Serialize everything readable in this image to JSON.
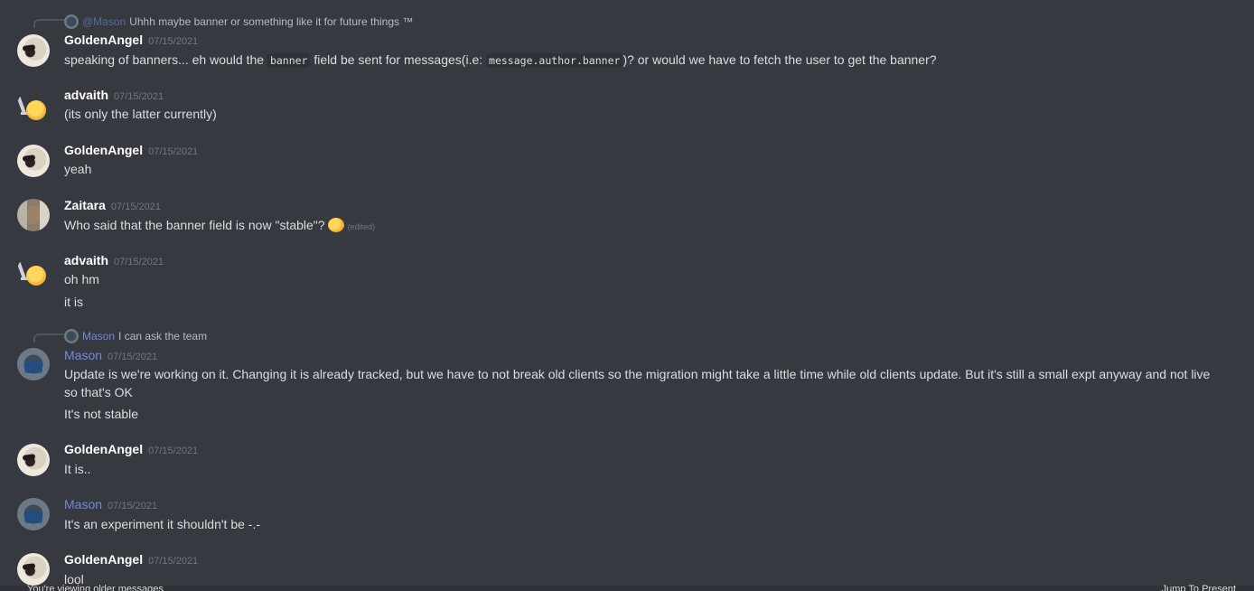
{
  "messages": [
    {
      "reply": {
        "mention": "@Mason",
        "text": "Uhhh maybe banner or something like it for future things ™"
      },
      "author": "GoldenAngel",
      "timestamp": "07/15/2021",
      "line1_a": "speaking of banners... eh would the ",
      "code1": "banner",
      "line1_b": " field be sent for messages(i.e: ",
      "code2": "message.author.banner",
      "line1_c": ")? or would we have to fetch the user to get the banner?"
    },
    {
      "author": "advaith",
      "timestamp": "07/15/2021",
      "text": "(its only the latter currently)"
    },
    {
      "author": "GoldenAngel",
      "timestamp": "07/15/2021",
      "text": "yeah"
    },
    {
      "author": "Zaitara",
      "timestamp": "07/15/2021",
      "text": "Who said that the banner field is now \"stable\"?",
      "edited": "(edited)"
    },
    {
      "author": "advaith",
      "timestamp": "07/15/2021",
      "text": "oh hm",
      "text2": "it is"
    },
    {
      "reply": {
        "mention": "Mason",
        "text": "I can ask the team"
      },
      "author": "Mason",
      "timestamp": "07/15/2021",
      "text": "Update is we're working on it. Changing it is already tracked, but we have to not break old clients so the migration might take a little time while old clients update. But it's still a small expt anyway and not live so that's OK",
      "text2": "It's not stable"
    },
    {
      "author": "GoldenAngel",
      "timestamp": "07/15/2021",
      "text": "It is.."
    },
    {
      "author": "Mason",
      "timestamp": "07/15/2021",
      "text": "It's an experiment it shouldn't be -.-"
    },
    {
      "author": "GoldenAngel",
      "timestamp": "07/15/2021",
      "text": "lool"
    }
  ],
  "bottom": {
    "left": "You're viewing older messages",
    "right": "Jump To Present"
  },
  "colors": {
    "background": "#36393f",
    "mention": "#7289da",
    "timestamp": "#72767d"
  }
}
